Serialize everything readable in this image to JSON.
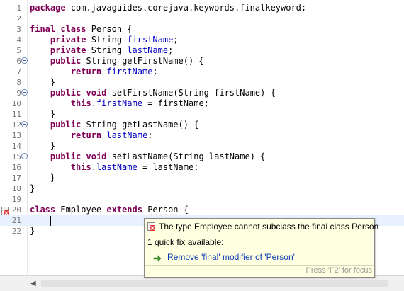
{
  "editor": {
    "lines": [
      {
        "num": "1",
        "fold": false,
        "segments": [
          {
            "t": "kw",
            "v": "package"
          },
          {
            "t": "p",
            "v": " com.javaguides.corejava.keywords.finalkeyword;"
          }
        ]
      },
      {
        "num": "2",
        "fold": false,
        "segments": []
      },
      {
        "num": "3",
        "fold": false,
        "segments": [
          {
            "t": "kw",
            "v": "final"
          },
          {
            "t": "p",
            "v": " "
          },
          {
            "t": "kw",
            "v": "class"
          },
          {
            "t": "p",
            "v": " Person {"
          }
        ]
      },
      {
        "num": "4",
        "fold": false,
        "segments": [
          {
            "t": "p",
            "v": "    "
          },
          {
            "t": "kw",
            "v": "private"
          },
          {
            "t": "p",
            "v": " String "
          },
          {
            "t": "field",
            "v": "firstName"
          },
          {
            "t": "p",
            "v": ";"
          }
        ]
      },
      {
        "num": "5",
        "fold": false,
        "segments": [
          {
            "t": "p",
            "v": "    "
          },
          {
            "t": "kw",
            "v": "private"
          },
          {
            "t": "p",
            "v": " String "
          },
          {
            "t": "field",
            "v": "lastName"
          },
          {
            "t": "p",
            "v": ";"
          }
        ]
      },
      {
        "num": "6",
        "fold": true,
        "segments": [
          {
            "t": "p",
            "v": "    "
          },
          {
            "t": "kw",
            "v": "public"
          },
          {
            "t": "p",
            "v": " String getFirstName() {"
          }
        ]
      },
      {
        "num": "7",
        "fold": false,
        "segments": [
          {
            "t": "p",
            "v": "        "
          },
          {
            "t": "kw",
            "v": "return"
          },
          {
            "t": "p",
            "v": " "
          },
          {
            "t": "field",
            "v": "firstName"
          },
          {
            "t": "p",
            "v": ";"
          }
        ]
      },
      {
        "num": "8",
        "fold": false,
        "segments": [
          {
            "t": "p",
            "v": "    }"
          }
        ]
      },
      {
        "num": "9",
        "fold": true,
        "segments": [
          {
            "t": "p",
            "v": "    "
          },
          {
            "t": "kw",
            "v": "public"
          },
          {
            "t": "p",
            "v": " "
          },
          {
            "t": "kw",
            "v": "void"
          },
          {
            "t": "p",
            "v": " setFirstName(String firstName) {"
          }
        ]
      },
      {
        "num": "10",
        "fold": false,
        "segments": [
          {
            "t": "p",
            "v": "        "
          },
          {
            "t": "kw",
            "v": "this"
          },
          {
            "t": "p",
            "v": "."
          },
          {
            "t": "field",
            "v": "firstName"
          },
          {
            "t": "p",
            "v": " = firstName;"
          }
        ]
      },
      {
        "num": "11",
        "fold": false,
        "segments": [
          {
            "t": "p",
            "v": "    }"
          }
        ]
      },
      {
        "num": "12",
        "fold": true,
        "segments": [
          {
            "t": "p",
            "v": "    "
          },
          {
            "t": "kw",
            "v": "public"
          },
          {
            "t": "p",
            "v": " String getLastName() {"
          }
        ]
      },
      {
        "num": "13",
        "fold": false,
        "segments": [
          {
            "t": "p",
            "v": "        "
          },
          {
            "t": "kw",
            "v": "return"
          },
          {
            "t": "p",
            "v": " "
          },
          {
            "t": "field",
            "v": "lastName"
          },
          {
            "t": "p",
            "v": ";"
          }
        ]
      },
      {
        "num": "14",
        "fold": false,
        "segments": [
          {
            "t": "p",
            "v": "    }"
          }
        ]
      },
      {
        "num": "15",
        "fold": true,
        "segments": [
          {
            "t": "p",
            "v": "    "
          },
          {
            "t": "kw",
            "v": "public"
          },
          {
            "t": "p",
            "v": " "
          },
          {
            "t": "kw",
            "v": "void"
          },
          {
            "t": "p",
            "v": " setLastName(String lastName) {"
          }
        ]
      },
      {
        "num": "16",
        "fold": false,
        "segments": [
          {
            "t": "p",
            "v": "        "
          },
          {
            "t": "kw",
            "v": "this"
          },
          {
            "t": "p",
            "v": "."
          },
          {
            "t": "field",
            "v": "lastName"
          },
          {
            "t": "p",
            "v": " = lastName;"
          }
        ]
      },
      {
        "num": "17",
        "fold": false,
        "segments": [
          {
            "t": "p",
            "v": "    }"
          }
        ]
      },
      {
        "num": "18",
        "fold": false,
        "segments": [
          {
            "t": "p",
            "v": "}"
          }
        ]
      },
      {
        "num": "19",
        "fold": false,
        "segments": []
      },
      {
        "num": "20",
        "fold": false,
        "error": true,
        "segments": [
          {
            "t": "kw",
            "v": "class"
          },
          {
            "t": "p",
            "v": " Employee "
          },
          {
            "t": "kw",
            "v": "extends"
          },
          {
            "t": "p",
            "v": " "
          },
          {
            "t": "err",
            "v": "Person"
          },
          {
            "t": "p",
            "v": " {"
          }
        ]
      },
      {
        "num": "21",
        "fold": false,
        "current": true,
        "segments": []
      },
      {
        "num": "22",
        "fold": false,
        "segments": [
          {
            "t": "p",
            "v": "}"
          }
        ]
      }
    ]
  },
  "quickfix_popup": {
    "message": "The type Employee cannot subclass the final class Person",
    "fix_count": "1 quick fix available:",
    "fix_label": "Remove 'final' modifier of 'Person'",
    "footer": "Press 'F2' for focus"
  },
  "colors": {
    "keyword": "#7f0055",
    "field": "#0000c0",
    "current_line": "#e8f2fe",
    "popup_bg": "#ffffe1",
    "link": "#0b3bb4",
    "error": "#e00000"
  }
}
